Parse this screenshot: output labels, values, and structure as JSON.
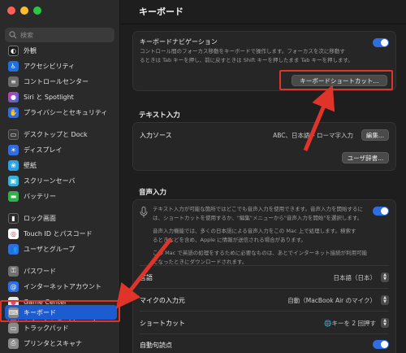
{
  "sidebar": {
    "search_placeholder": "検索",
    "items": [
      {
        "label": "外観",
        "icon": "appearance-icon",
        "color": "#1c1c1c"
      },
      {
        "label": "アクセシビリティ",
        "icon": "accessibility-icon",
        "color": "#1f6fe0"
      },
      {
        "label": "コントロールセンター",
        "icon": "control-center-icon",
        "color": "#6b6b6b"
      },
      {
        "label": "Siri と Spotlight",
        "icon": "siri-icon",
        "color": "#8a3bd6"
      },
      {
        "label": "プライバシーとセキュリティ",
        "icon": "privacy-hand-icon",
        "color": "#2f6ee0"
      },
      {
        "label": "デスクトップと Dock",
        "icon": "dock-icon",
        "color": "#3a3a3a"
      },
      {
        "label": "ディスプレイ",
        "icon": "display-icon",
        "color": "#2f6ee0"
      },
      {
        "label": "壁紙",
        "icon": "wallpaper-icon",
        "color": "#2ba3e6"
      },
      {
        "label": "スクリーンセーバ",
        "icon": "screensaver-icon",
        "color": "#38b2d6"
      },
      {
        "label": "バッテリー",
        "icon": "battery-icon",
        "color": "#32b14a"
      },
      {
        "label": "ロック画面",
        "icon": "lock-screen-icon",
        "color": "#2b2b2b"
      },
      {
        "label": "Touch ID とパスコード",
        "icon": "touch-id-icon",
        "color": "#e54343"
      },
      {
        "label": "ユーザとグループ",
        "icon": "users-icon",
        "color": "#2f6ee0"
      },
      {
        "label": "パスワード",
        "icon": "key-icon",
        "color": "#707070"
      },
      {
        "label": "インターネットアカウント",
        "icon": "at-sign-icon",
        "color": "#2f6ee0"
      },
      {
        "label": "Game Center",
        "icon": "game-center-icon",
        "color": "#e8e8e8"
      },
      {
        "label": "ウォレットと Apple Pay",
        "icon": "wallet-icon",
        "color": "#1f1f1f"
      },
      {
        "label": "キーボード",
        "icon": "keyboard-icon",
        "color": "#8a8a8a"
      },
      {
        "label": "トラックパッド",
        "icon": "trackpad-icon",
        "color": "#8a8a8a"
      },
      {
        "label": "プリンタとスキャナ",
        "icon": "printer-icon",
        "color": "#8a8a8a"
      }
    ]
  },
  "main": {
    "title": "キーボード",
    "nav": {
      "title": "キーボードナビゲーション",
      "desc1": "コントロール間のフォーカス移動をキーボードで操作します。フォーカスを次に移動す",
      "desc2": "るときは Tab キーを押し、前に戻すときは Shift キーを押したまま Tab キーを押します。",
      "shortcut_button": "キーボードショートカット..."
    },
    "text_input": {
      "heading": "テキスト入力",
      "input_sources_label": "入力ソース",
      "input_sources_value": "ABC、日本語 – ローマ字入力",
      "edit_button": "編集...",
      "user_dict_button": "ユーザ辞書..."
    },
    "voice": {
      "heading": "音声入力",
      "desc_lines": [
        "テキスト入力が可能な箇所ではどこでも音声入力を使用できます。音声入力を開始するに",
        "は、ショートカットを使用するか、\"編集\"メニューから\"音声入力を開始\"を選択します。",
        "音声入力機能では、多くの日本語による音声入力をこの Mac 上で処理します。検索す",
        "るときなどを含め、Apple に情報が送信される場合があります。",
        "この Mac で英語の処理をするために必要なものは、あとでインターネット接続が利用可能",
        "になったときにダウンロードされます。"
      ],
      "language_label": "言語",
      "language_value": "日本語（日本）",
      "mic_label": "マイクの入力元",
      "mic_value": "自動（MacBook Air のマイク）",
      "shortcut_label": "ショートカット",
      "shortcut_value": "🌐キーを 2 回押す",
      "auto_punct_label": "自動句読点"
    }
  },
  "colors": {
    "accent": "#2f6ee0",
    "selected_row": "#1d5bd0",
    "annotation_red": "#e0342a"
  }
}
